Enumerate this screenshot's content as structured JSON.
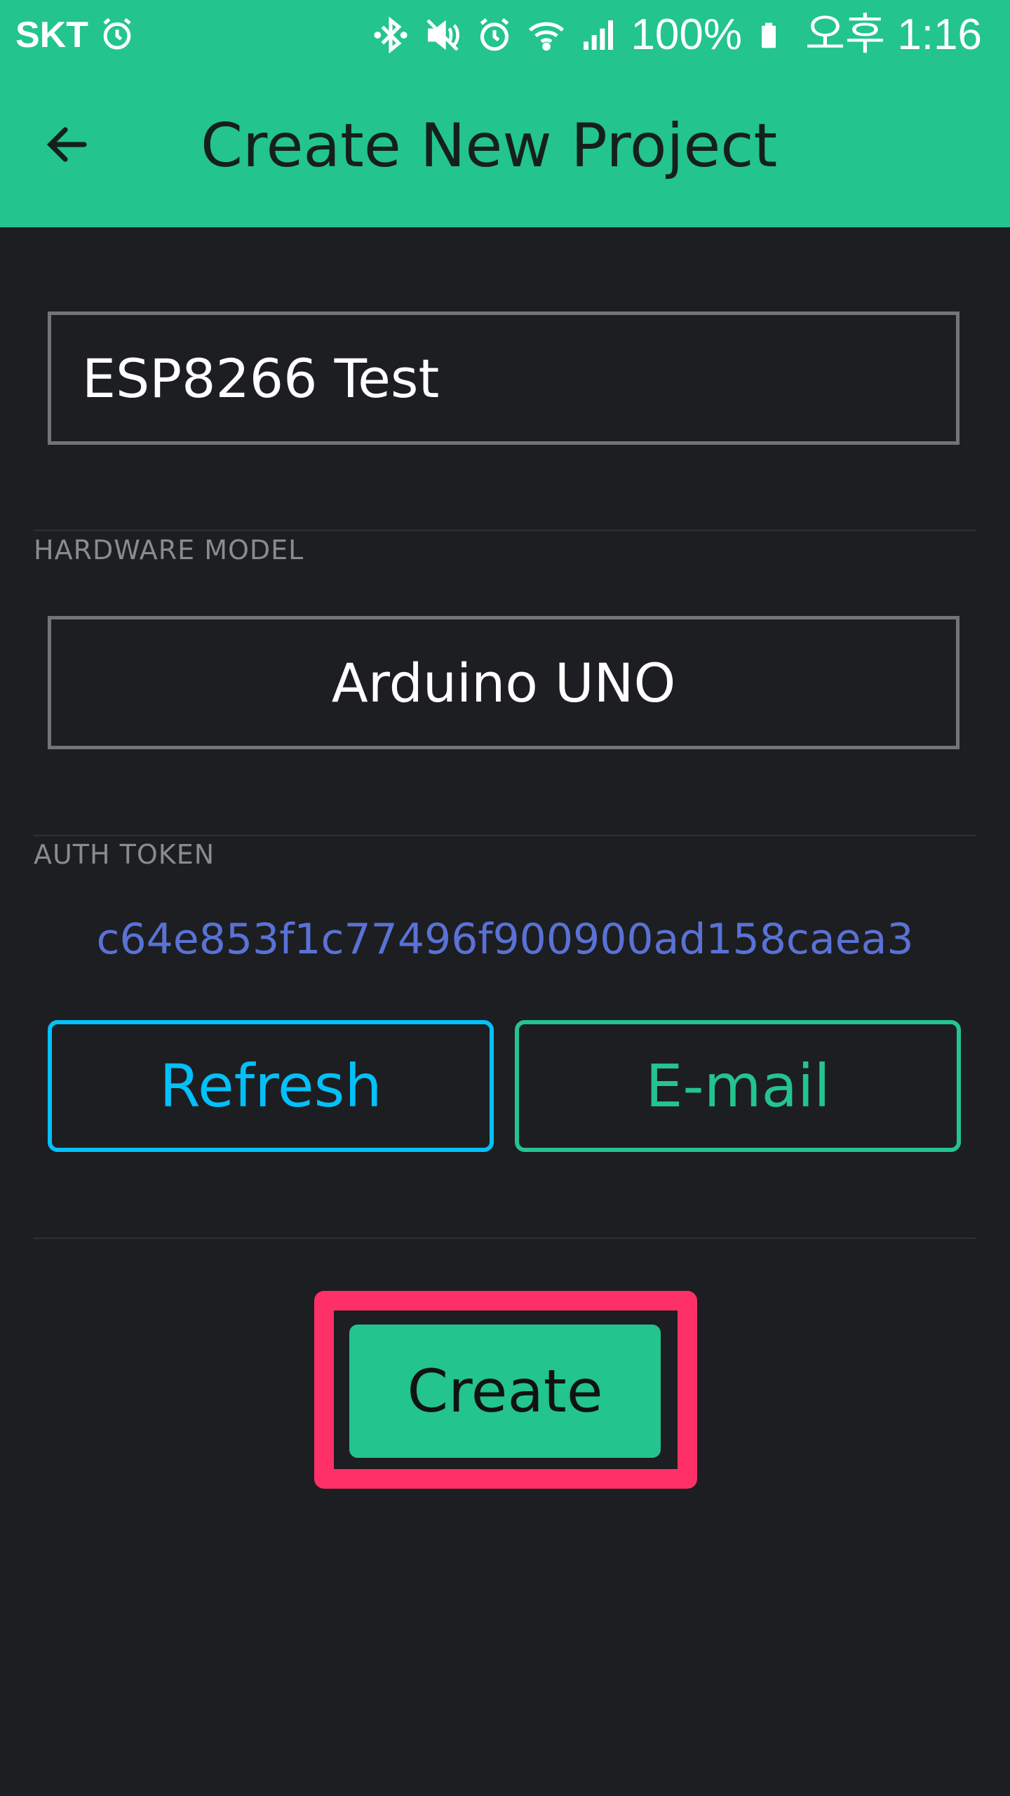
{
  "status_bar": {
    "carrier": "SKT",
    "battery": "100%",
    "time": "오후 1:16",
    "icons": [
      "alarm-icon",
      "bluetooth-icon",
      "mute-icon",
      "alarm-icon",
      "wifi-icon",
      "signal-icon",
      "battery-icon"
    ]
  },
  "toolbar": {
    "title": "Create New Project",
    "back_icon": "arrow-left-icon"
  },
  "project": {
    "name_value": "ESP8266 Test"
  },
  "hardware": {
    "label": "HARDWARE MODEL",
    "selected": "Arduino UNO"
  },
  "auth": {
    "label": "AUTH TOKEN",
    "token": "c64e853f1c77496f900900ad158caea3",
    "refresh_label": "Refresh",
    "email_label": "E-mail"
  },
  "actions": {
    "create_label": "Create"
  },
  "colors": {
    "accent": "#23c48e",
    "background": "#1d1e21",
    "refresh": "#04c0f8",
    "token": "#5a72d6",
    "highlight": "#ff3068"
  }
}
